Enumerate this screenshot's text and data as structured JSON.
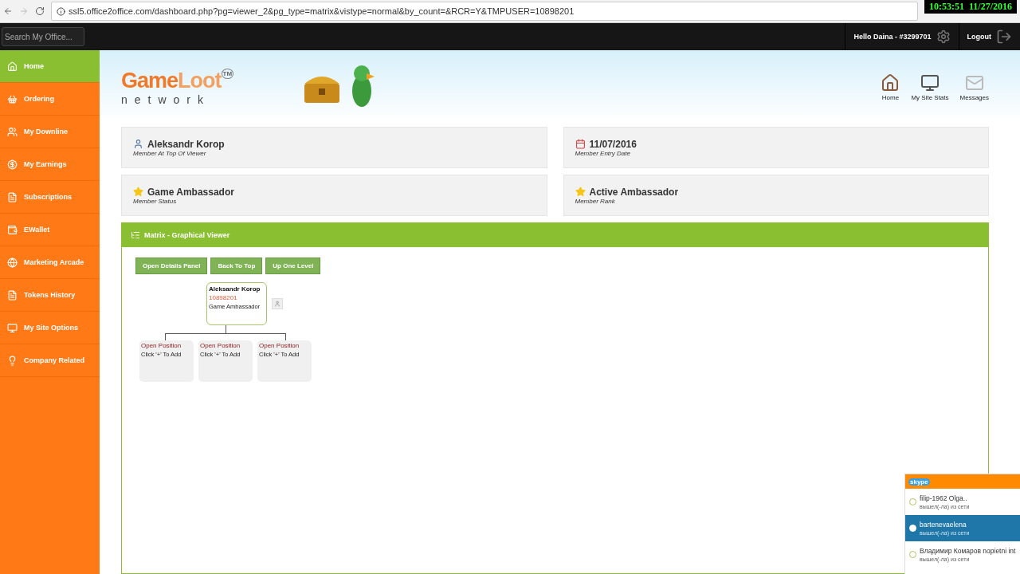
{
  "browser": {
    "url": "ssl5.office2office.com/dashboard.php?pg=viewer_2&pg_type=matrix&vistype=normal&by_count=&RCR=Y&TMPUSER=10898201",
    "clock": "10:53:51  11/27/2016"
  },
  "topbar": {
    "search": {
      "placeholder": "Search My Office..."
    },
    "greeting": "Hello Daina - #3299701",
    "logout": "Logout"
  },
  "sidebar": {
    "items": [
      {
        "label": "Home",
        "selected": true
      },
      {
        "label": "Ordering",
        "selected": false
      },
      {
        "label": "My Downline",
        "selected": false
      },
      {
        "label": "My Earnings",
        "selected": false
      },
      {
        "label": "Subscriptions",
        "selected": false
      },
      {
        "label": "EWallet",
        "selected": false
      },
      {
        "label": "Marketing Arcade",
        "selected": false
      },
      {
        "label": "Tokens History",
        "selected": false
      },
      {
        "label": "My Site Options",
        "selected": false
      },
      {
        "label": "Company Related",
        "selected": false
      }
    ]
  },
  "banner": {
    "logo": {
      "word1": "Game",
      "word2": "Loot",
      "tm": "TM",
      "sub": "network"
    },
    "links": [
      "Home",
      "My Site Stats",
      "Messages"
    ]
  },
  "cards": [
    {
      "kind": "person",
      "value": "Aleksandr Korop",
      "caption": "Member At Top Of Viewer"
    },
    {
      "kind": "date",
      "value": "11/07/2016",
      "caption": "Member Entry Date"
    },
    {
      "kind": "star",
      "value": "Game Ambassador",
      "caption": "Member Status"
    },
    {
      "kind": "star",
      "value": "Active Ambassador",
      "caption": "Member Rank"
    }
  ],
  "matrix": {
    "title": "Matrix - Graphical Viewer",
    "buttons": [
      "Open Details Panel",
      "Back To Top",
      "Up One Level"
    ],
    "root": {
      "name": "Aleksandr Korop",
      "id": "10898201",
      "rank": "Game Ambassador"
    },
    "children": [
      {
        "title": "Open Position",
        "hint": "Click '+' To Add"
      },
      {
        "title": "Open Position",
        "hint": "Click '+' To Add"
      },
      {
        "title": "Open Position",
        "hint": "Click '+' To Add"
      }
    ]
  },
  "skype": {
    "brand": "skype",
    "contacts": [
      {
        "name": "filip-1962 Olga..",
        "status": "вышел(-ла) из сети",
        "selected": false
      },
      {
        "name": "bartenevaelena",
        "status": "вышел(-ла) из сети",
        "selected": true
      },
      {
        "name": "Владимир Комаров nopietni int",
        "status": "вышел(-ла) из сети",
        "selected": false
      }
    ]
  }
}
